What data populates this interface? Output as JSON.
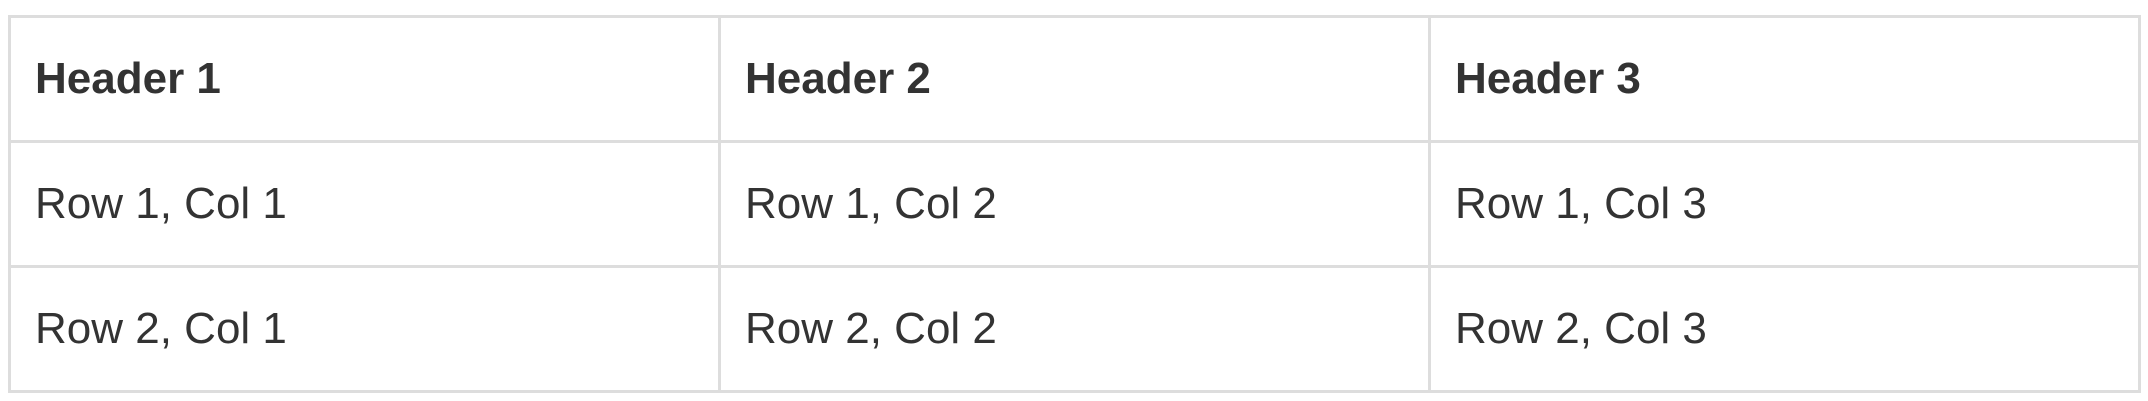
{
  "table": {
    "headers": [
      "Header 1",
      "Header 2",
      "Header 3"
    ],
    "rows": [
      [
        "Row 1, Col 1",
        "Row 1, Col 2",
        "Row 1, Col 3"
      ],
      [
        "Row 2, Col 1",
        "Row 2, Col 2",
        "Row 2, Col 3"
      ]
    ]
  },
  "colors": {
    "text": "#333333",
    "border": "#dddddd",
    "background": "#ffffff"
  }
}
